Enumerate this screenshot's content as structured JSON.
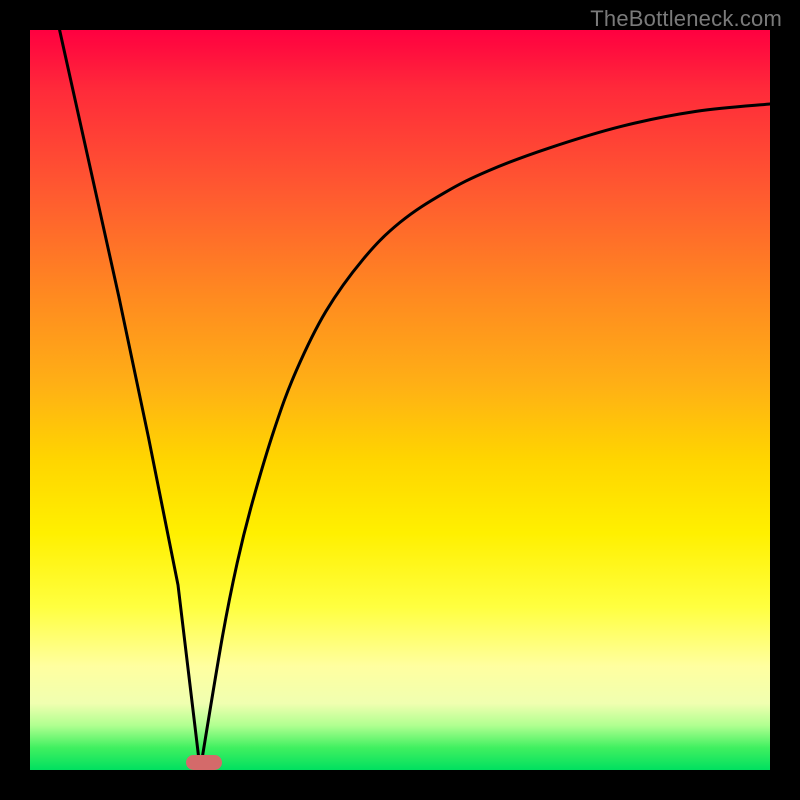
{
  "watermark": "TheBottleneck.com",
  "colors": {
    "frame": "#000000",
    "curve": "#000000",
    "marker": "#d46a6a",
    "gradient_top": "#ff0040",
    "gradient_bottom": "#00e060"
  },
  "chart_data": {
    "type": "line",
    "title": "",
    "xlabel": "",
    "ylabel": "",
    "xlim": [
      0,
      100
    ],
    "ylim": [
      0,
      100
    ],
    "curve_description": "Bottleneck-style curve: steep linear descent from top-left to a minimum near x≈23, then a concave-rising curve approaching the top-right.",
    "series": [
      {
        "name": "left-branch",
        "x": [
          4,
          8,
          12,
          16,
          20,
          23
        ],
        "values": [
          100,
          82,
          64,
          45,
          25,
          0
        ]
      },
      {
        "name": "right-branch",
        "x": [
          23,
          26,
          28,
          30,
          33,
          36,
          40,
          45,
          50,
          56,
          62,
          70,
          80,
          90,
          100
        ],
        "values": [
          0,
          18,
          28,
          36,
          46,
          54,
          62,
          69,
          74,
          78,
          81,
          84,
          87,
          89,
          90
        ]
      }
    ],
    "marker": {
      "x": 23.5,
      "y": 1,
      "rx": 2.4,
      "ry": 1
    }
  }
}
